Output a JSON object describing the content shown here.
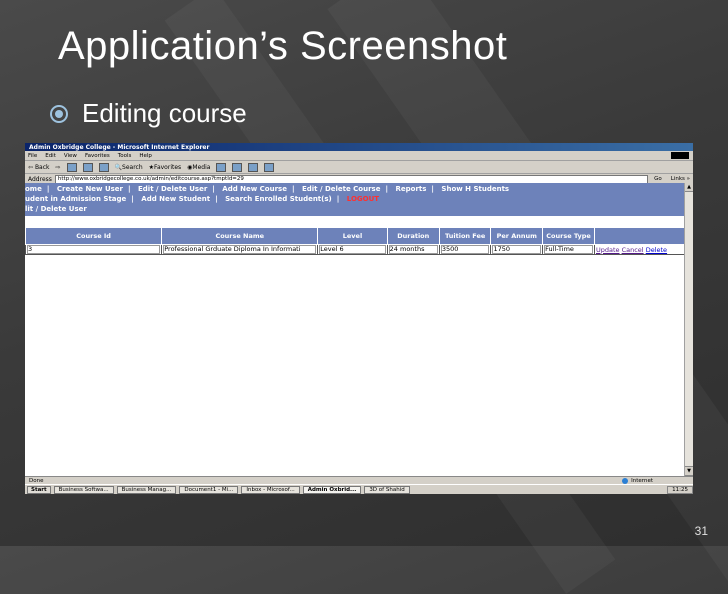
{
  "slide": {
    "title": "Application’s Screenshot",
    "bullet": "Editing course",
    "page_number": "31"
  },
  "window": {
    "title": "Admin Oxbridge College - Microsoft Internet Explorer",
    "menu": [
      "File",
      "Edit",
      "View",
      "Favorites",
      "Tools",
      "Help"
    ],
    "toolbar": {
      "back": "Back",
      "search": "Search",
      "favorites": "Favorites",
      "media": "Media"
    },
    "address_label": "Address",
    "url": "http://www.oxbridgecollege.co.uk/admin/editcourse.asp?tmptId=29",
    "go_label": "Go",
    "links_label": "Links »"
  },
  "nav": {
    "row1": [
      "ome",
      "Create New User",
      "Edit / Delete User",
      "Add New Course",
      "Edit / Delete Course",
      "Reports",
      "Show H Students"
    ],
    "row2": [
      "udent in Admission Stage",
      "Add New Student",
      "Search Enrolled Student(s)"
    ],
    "logout": "LOGOUT",
    "row3": "lit / Delete User"
  },
  "table": {
    "headers": [
      "Course Id",
      "Course Name",
      "Level",
      "Duration",
      "Tuition Fee",
      "Per Annum",
      "Course Type"
    ],
    "row": {
      "id": "3",
      "name": "Professional Grduate Diploma In Informati",
      "level": "Level 6",
      "duration": "24 months",
      "fee": "3500",
      "per_annum": "1750",
      "type": "Full-Time"
    },
    "actions": {
      "update": "Update",
      "cancel": "Cancel",
      "delete": "Delete"
    }
  },
  "status": {
    "left": "Done",
    "zone": "Internet"
  },
  "taskbar": {
    "start": "Start",
    "tasks": [
      "Business Softwa...",
      "Business Manag...",
      "Document1 - Mi...",
      "Inbox - Microsof...",
      "Admin Oxbrid...",
      "3D of Shahid"
    ],
    "clock": "11:25"
  }
}
